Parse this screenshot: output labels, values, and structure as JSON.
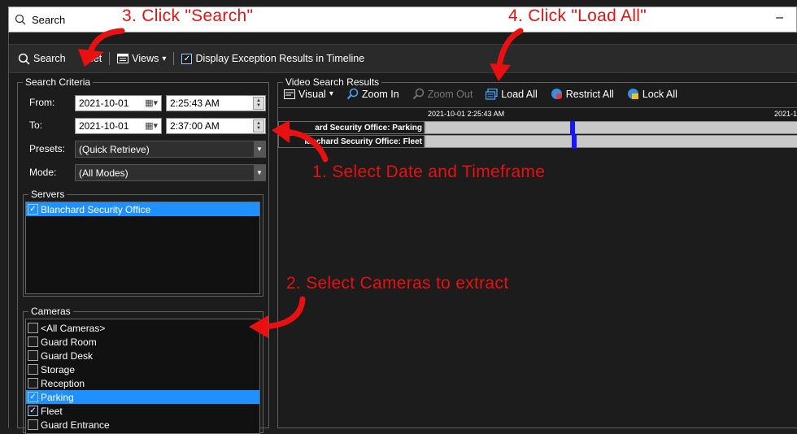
{
  "window": {
    "title": "Search",
    "minimize_glyph": "–"
  },
  "toolbar": {
    "search_label": "Search",
    "reset_label": "set",
    "views_label": "Views",
    "views_caret": "▾",
    "exception_label": "Display Exception Results in Timeline",
    "exception_checked": true
  },
  "criteria": {
    "title": "Search Criteria",
    "from_label": "From:",
    "from_date": "2021-10-01",
    "from_time": "2:25:43 AM",
    "to_label": "To:",
    "to_date": "2021-10-01",
    "to_time": "2:37:00 AM",
    "presets_label": "Presets:",
    "presets_value": "(Quick Retrieve)",
    "mode_label": "Mode:",
    "mode_value": "(All Modes)"
  },
  "servers": {
    "title": "Servers",
    "items": [
      {
        "label": "Blanchard Security Office",
        "checked": true,
        "selected": true
      }
    ]
  },
  "cameras": {
    "title": "Cameras",
    "items": [
      {
        "label": "<All Cameras>",
        "checked": false,
        "selected": false
      },
      {
        "label": "Guard Room",
        "checked": false,
        "selected": false
      },
      {
        "label": "Guard Desk",
        "checked": false,
        "selected": false
      },
      {
        "label": "Storage",
        "checked": false,
        "selected": false
      },
      {
        "label": "Reception",
        "checked": false,
        "selected": false
      },
      {
        "label": "Parking",
        "checked": true,
        "selected": true
      },
      {
        "label": "Fleet",
        "checked": true,
        "selected": false
      },
      {
        "label": "Guard Entrance",
        "checked": false,
        "selected": false
      }
    ]
  },
  "video": {
    "title": "Video Search Results",
    "visual_label": "Visual",
    "zoom_in_label": "Zoom In",
    "zoom_out_label": "Zoom Out",
    "load_all_label": "Load All",
    "restrict_all_label": "Restrict All",
    "lock_all_label": "Lock All",
    "timeline_start": "2021-10-01 2:25:43 AM",
    "timeline_next": "2021-1",
    "tracks": [
      {
        "label": "ard Security Office: Parking"
      },
      {
        "label": "lanchard Security Office: Fleet"
      }
    ]
  },
  "annotations": {
    "step1": "1. Select Date and Timeframe",
    "step2": "2. Select Cameras to extract",
    "step3": "3. Click \"Search\"",
    "step4": "4. Click \"Load All\"",
    "color": "#e81010"
  },
  "colors": {
    "selection": "#1e90ff",
    "marker": "#1515ff",
    "background": "#1c1c1c"
  }
}
